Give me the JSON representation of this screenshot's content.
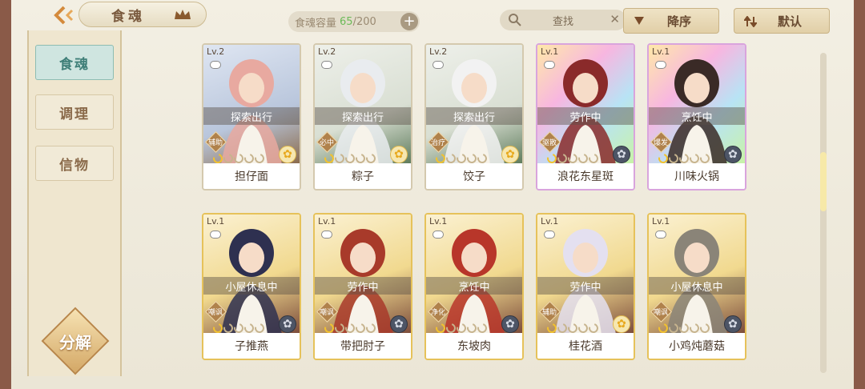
{
  "header": {
    "title": "食魂",
    "capacity_label": "食魂容量",
    "capacity_used": "65",
    "capacity_total": "/200",
    "search_label": "查找",
    "sort_order_label": "降序",
    "sort_mode_label": "默认"
  },
  "sidebar": {
    "tabs": [
      {
        "label": "食魂",
        "active": true
      },
      {
        "label": "调理",
        "active": false
      },
      {
        "label": "信物",
        "active": false
      }
    ],
    "decompose_label": "分解"
  },
  "colors": {
    "active_tab": "#cfe5e0",
    "gold_frame": "#e6c25a",
    "capacity_used": "#6cba58"
  },
  "cards": [
    {
      "level": "Lv.2",
      "status": "探索出行",
      "role": "辅助",
      "name": "担仔面",
      "stars_on": 1,
      "element": "sun-icon",
      "rarity": "blue"
    },
    {
      "level": "Lv.2",
      "status": "探索出行",
      "role": "必中",
      "name": "粽子",
      "stars_on": 1,
      "element": "sun-icon",
      "rarity": "white"
    },
    {
      "level": "Lv.2",
      "status": "探索出行",
      "role": "治疗",
      "name": "饺子",
      "stars_on": 1,
      "element": "sun-icon",
      "rarity": "white"
    },
    {
      "level": "Lv.1",
      "status": "劳作中",
      "role": "驱散",
      "name": "浪花东星斑",
      "stars_on": 1,
      "element": "moon-icon",
      "rarity": "rainbow"
    },
    {
      "level": "Lv.1",
      "status": "烹饪中",
      "role": "爆发",
      "name": "川味火锅",
      "stars_on": 1,
      "element": "moon-icon",
      "rarity": "rainbow"
    },
    {
      "level": "Lv.1",
      "status": "小屋休息中",
      "role": "嘲讽",
      "name": "子推燕",
      "stars_on": 1,
      "element": "moon-icon",
      "rarity": "gold"
    },
    {
      "level": "Lv.1",
      "status": "劳作中",
      "role": "嘲讽",
      "name": "带把肘子",
      "stars_on": 1,
      "element": "moon-icon",
      "rarity": "gold"
    },
    {
      "level": "Lv.1",
      "status": "烹饪中",
      "role": "净化",
      "name": "东坡肉",
      "stars_on": 1,
      "element": "moon-icon",
      "rarity": "gold"
    },
    {
      "level": "Lv.1",
      "status": "劳作中",
      "role": "辅助",
      "name": "桂花酒",
      "stars_on": 1,
      "element": "sun-icon",
      "rarity": "gold"
    },
    {
      "level": "Lv.1",
      "status": "小屋休息中",
      "role": "嘲讽",
      "name": "小鸡炖蘑菇",
      "stars_on": 1,
      "element": "moon-icon",
      "rarity": "gold"
    }
  ]
}
